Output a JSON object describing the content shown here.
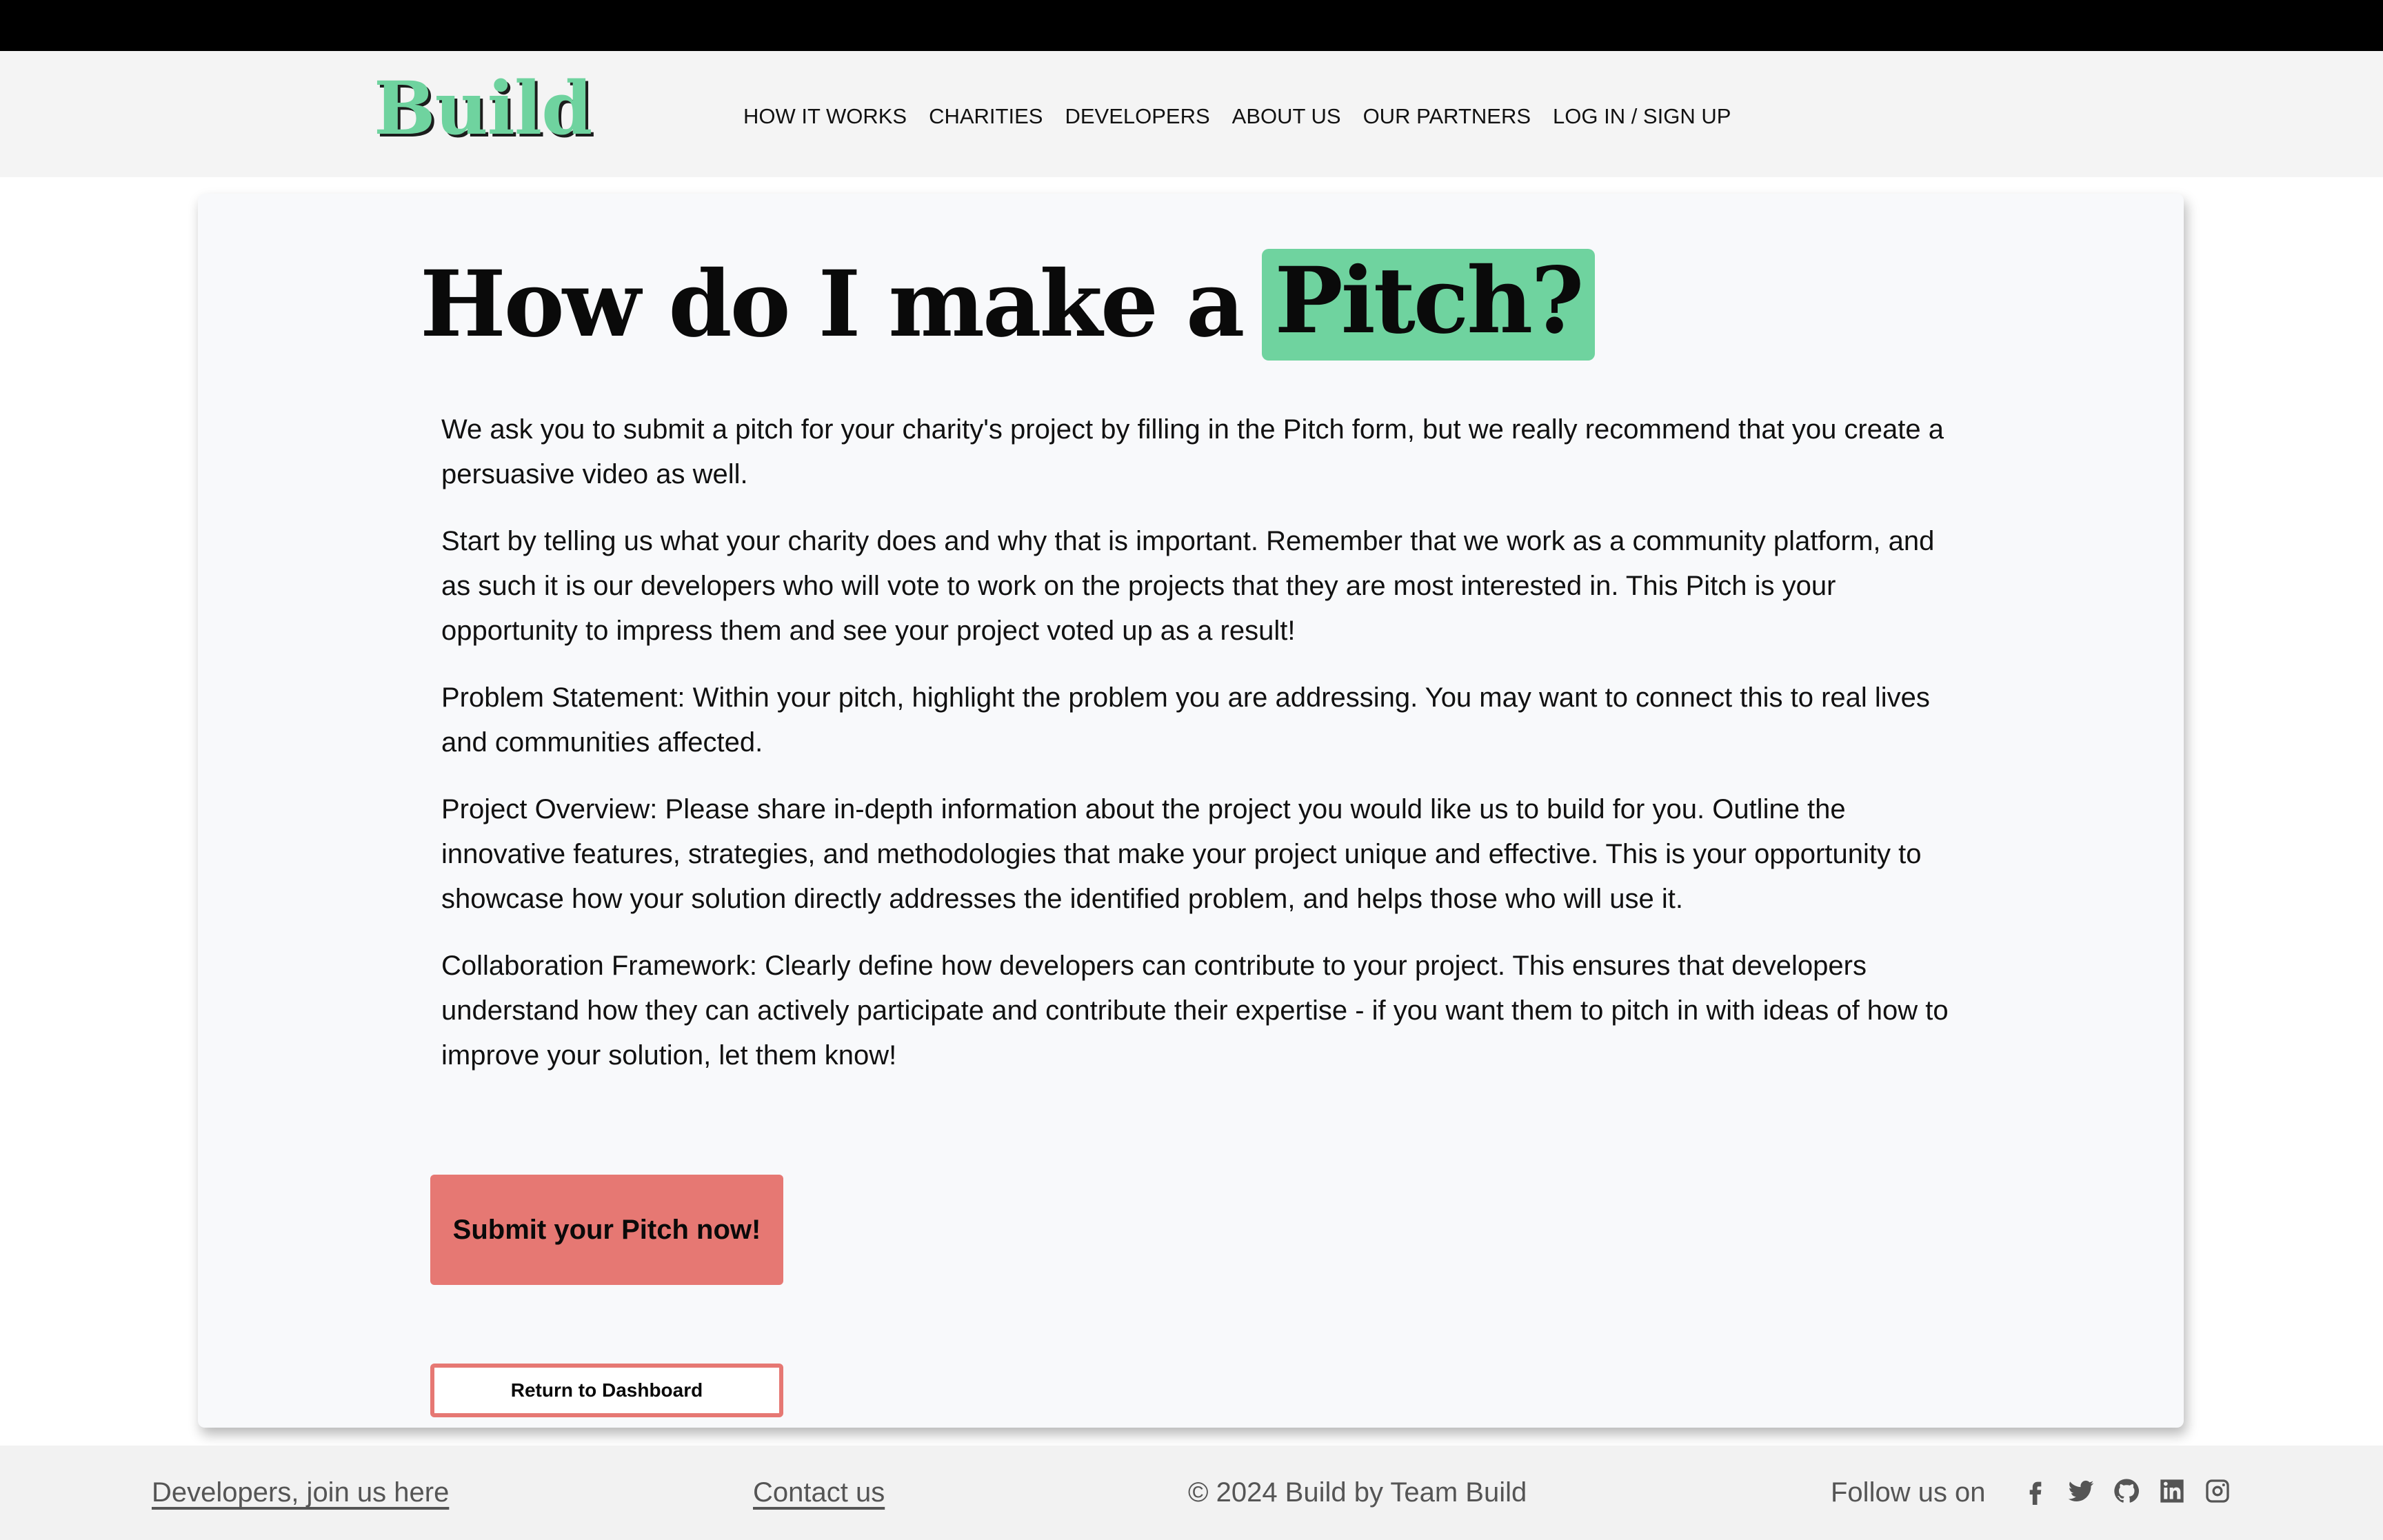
{
  "header": {
    "logo": "Build",
    "nav": [
      {
        "label": "HOW IT WORKS"
      },
      {
        "label": "CHARITIES"
      },
      {
        "label": "DEVELOPERS"
      },
      {
        "label": "ABOUT US"
      },
      {
        "label": "OUR PARTNERS"
      },
      {
        "label": "LOG IN / SIGN UP"
      }
    ]
  },
  "main": {
    "title_prefix": "How do I make a",
    "title_highlight": "Pitch?",
    "paragraphs": [
      "We ask you to submit a pitch for your charity's project by filling in the Pitch form, but we really recommend that you create a persuasive video as well.",
      "Start by telling us what your charity does and why that is important. Remember that we work as a community platform, and as such it is our developers who will vote to work on the projects that they are most interested in. This Pitch is your opportunity to impress them and see your project voted up as a result!",
      "Problem Statement: Within your pitch, highlight the problem you are addressing. You may want to connect this to real lives and communities affected.",
      "Project Overview: Please share in-depth information about the project you would like us to build for you. Outline the innovative features, strategies, and methodologies that make your project unique and effective. This is your opportunity to showcase how your solution directly addresses the identified problem, and helps those who will use it.",
      "Collaboration Framework: Clearly define how developers can contribute to your project. This ensures that developers understand how they can actively participate and contribute their expertise - if you want them to pitch in with ideas of how to improve your solution, let them know!"
    ],
    "submit_label": "Submit your Pitch now!",
    "return_label": "Return to Dashboard"
  },
  "footer": {
    "developers_link": "Developers, join us here",
    "contact_link": "Contact us",
    "copyright": "© 2024 Build by Team Build",
    "follow_label": "Follow us on",
    "social_icons": [
      "facebook-icon",
      "twitter-icon",
      "github-icon",
      "linkedin-icon",
      "instagram-icon"
    ]
  },
  "colors": {
    "accent_green": "#6fd39f",
    "button_red": "#e67873",
    "header_bg": "#f4f4f4",
    "card_bg": "#f8f9fb"
  }
}
